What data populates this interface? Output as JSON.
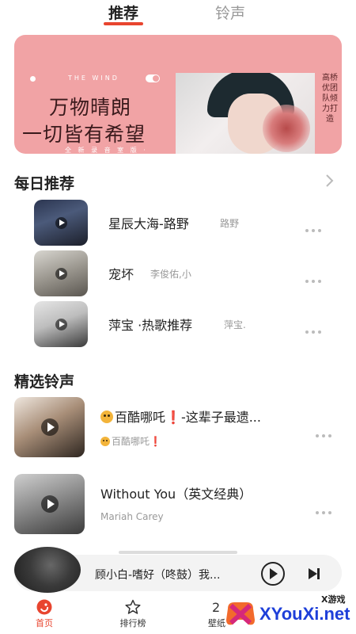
{
  "top_tabs": {
    "recommend": "推荐",
    "ringtone": "铃声"
  },
  "banner": {
    "english": "THE WIND",
    "line1": "万物晴朗",
    "line2": "一切皆有希望",
    "small": "全 新 录 音 室 版 ·",
    "side_text": "高桥优团队倾力打造"
  },
  "daily": {
    "title": "每日推荐",
    "items": [
      {
        "title": "星辰大海-路野",
        "artist": "路野"
      },
      {
        "title": "宠坏",
        "artist": "李俊佑,小"
      },
      {
        "title": "萍宝 ·热歌推荐",
        "artist": "萍宝."
      }
    ]
  },
  "featured": {
    "title": "精选铃声",
    "items": [
      {
        "title": "百酷哪吒",
        "title_suffix": "-这辈子最遗...",
        "artist": "百酷哪吒"
      },
      {
        "title": "Without You（英文经典）",
        "artist": "Mariah Carey"
      }
    ]
  },
  "player": {
    "title": "顾小白-嗜好（咚鼓）我..."
  },
  "bottom_nav": {
    "home": "首页",
    "charts": "排行榜",
    "wallpaper": "壁纸"
  },
  "watermark": {
    "brand": "XYouXi.net",
    "small": "X游戏"
  },
  "colors": {
    "accent": "#e8452f",
    "banner_bg": "#f1a3a5"
  }
}
